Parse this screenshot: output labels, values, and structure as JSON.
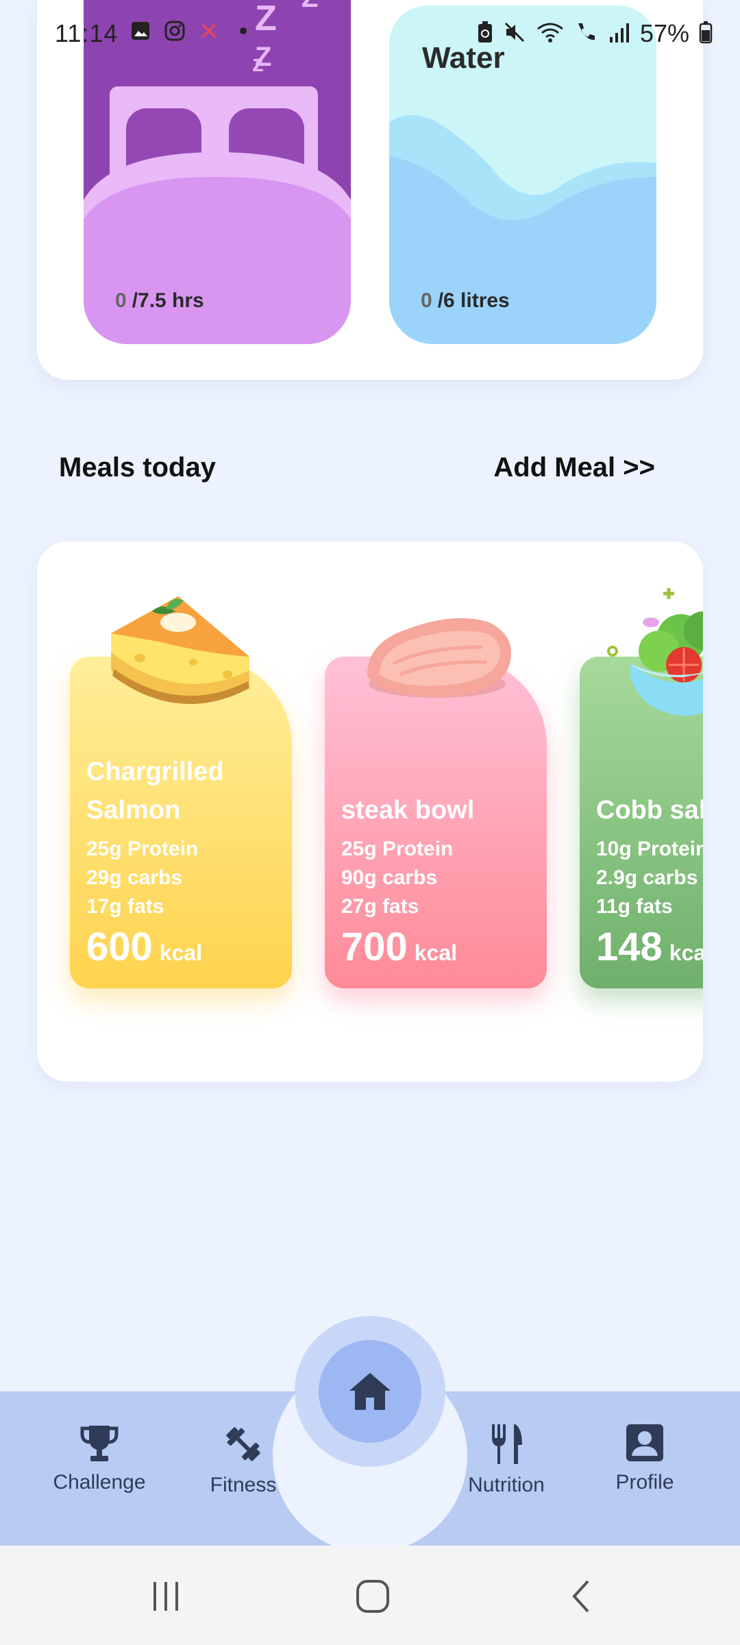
{
  "status_bar": {
    "time": "11:14",
    "battery_percent": "57%",
    "left_icons": [
      "gallery-icon",
      "instagram-icon",
      "app-alert-icon",
      "dot-icon"
    ],
    "right_icons": [
      "battery-saver-icon",
      "mute-icon",
      "wifi-icon",
      "call-icon",
      "signal-icon",
      "battery-icon"
    ]
  },
  "activity_tiles": {
    "sleep": {
      "current": "0",
      "target": "/7.5 hrs",
      "color": "#8E44B0"
    },
    "water": {
      "title": "Water",
      "current": "0",
      "target": "/6 litres",
      "color": "#9BD3FB"
    }
  },
  "meals": {
    "title": "Meals today",
    "add_label": "Add Meal >>",
    "items": [
      {
        "name": "Chargrilled Salmon",
        "protein": "25g Protein",
        "carbs": "29g carbs",
        "fats": "17g fats",
        "kcal": "600",
        "kcal_unit": "kcal",
        "icon": "cheesecake-icon"
      },
      {
        "name": "steak bowl",
        "protein": "25g Protein",
        "carbs": "90g carbs",
        "fats": "27g fats",
        "kcal": "700",
        "kcal_unit": "kcal",
        "icon": "chicken-breast-icon"
      },
      {
        "name": "Cobb salad",
        "protein": "10g Protein",
        "carbs": "2.9g carbs",
        "fats": "11g fats",
        "kcal": "148",
        "kcal_unit": "kcal",
        "icon": "salad-bowl-icon"
      }
    ]
  },
  "bottom_nav": {
    "items": [
      {
        "label": "Challenge",
        "icon": "trophy-icon"
      },
      {
        "label": "Fitness",
        "icon": "dumbbell-icon"
      },
      {
        "label": "Home",
        "icon": "home-icon"
      },
      {
        "label": "Nutrition",
        "icon": "fork-knife-icon"
      },
      {
        "label": "Profile",
        "icon": "profile-icon"
      }
    ]
  },
  "system_nav": {
    "icons": [
      "recent-apps-icon",
      "home-circle-icon",
      "back-icon"
    ]
  }
}
